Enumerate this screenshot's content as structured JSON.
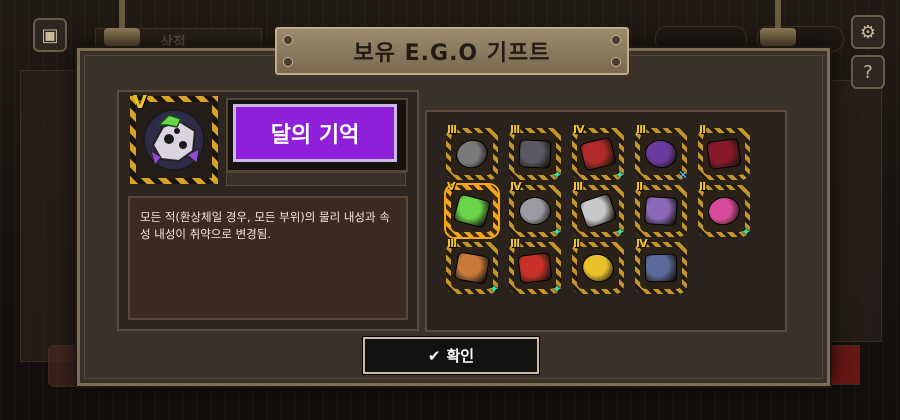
{
  "background": {
    "shop_tab": "상점",
    "right_tab_a": "",
    "right_tab_b": "",
    "bottom_left_counter": "",
    "settings_icon": "gear-icon",
    "help_icon": "question-icon",
    "inventory_icon": "box-icon"
  },
  "modal": {
    "title": "보유 E.G.O 기프트",
    "selected_gift": {
      "grade": "V",
      "name": "달의 기억",
      "description": "모든 적(환상체일 경우, 모든 부위)의 물리 내성과 속성 내성이 취약으로 변경됨."
    },
    "confirm_label": "확인",
    "confirm_icon": "check-icon"
  },
  "gifts": [
    {
      "grade": "III",
      "icon": "armor-shard-icon",
      "badge": "",
      "color": "#7a7a7a"
    },
    {
      "grade": "III",
      "icon": "crossbow-icon",
      "badge": "✦",
      "color": "#5a5a62"
    },
    {
      "grade": "IV",
      "icon": "red-wheel-icon",
      "badge": "✦",
      "color": "#b02a2a"
    },
    {
      "grade": "III",
      "icon": "purple-weapon-icon",
      "badge": "✕",
      "color": "#6a3aa0"
    },
    {
      "grade": "II",
      "icon": "dark-scythe-icon",
      "badge": "",
      "color": "#8a1a2a"
    },
    {
      "grade": "V",
      "icon": "moon-memory-icon",
      "badge": "",
      "color": "#6ad44a"
    },
    {
      "grade": "IV",
      "icon": "blades-icon",
      "badge": "✦",
      "color": "#9a9aa2"
    },
    {
      "grade": "III",
      "icon": "sword-ring-icon",
      "badge": "✦",
      "color": "#c8c8c8"
    },
    {
      "grade": "II",
      "icon": "purple-card-icon",
      "badge": "",
      "color": "#8a6ab8"
    },
    {
      "grade": "II",
      "icon": "pink-box-icon",
      "badge": "✦",
      "color": "#d84a9a"
    },
    {
      "grade": "III",
      "icon": "bread-icon",
      "badge": "✦",
      "color": "#c87a3a"
    },
    {
      "grade": "III",
      "icon": "red-bowl-icon",
      "badge": "✦",
      "color": "#c8302a"
    },
    {
      "grade": "II",
      "icon": "gold-coin-icon",
      "badge": "",
      "color": "#e8c02a"
    },
    {
      "grade": "IV",
      "icon": "photo-icon",
      "badge": "",
      "color": "#5a6a9a"
    }
  ]
}
